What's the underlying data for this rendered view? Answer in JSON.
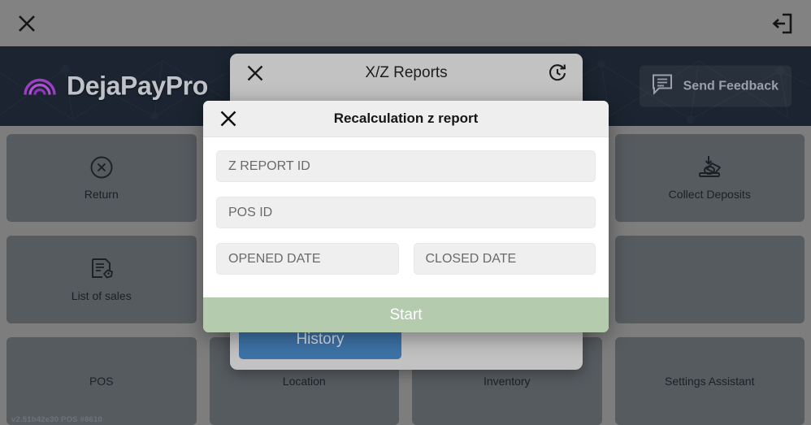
{
  "sysbar": {
    "close_icon": "close-x-icon",
    "logout_icon": "logout-icon"
  },
  "header": {
    "brand_name": "DejaPayPro",
    "brand_icon": "rainbow-arch-logo-icon",
    "feedback_label": "Send Feedback",
    "feedback_icon": "message-bubble-icon",
    "background_color": "#1b2430"
  },
  "tiles": {
    "row1": [
      {
        "label": "Return",
        "icon": "circle-x-icon"
      },
      {
        "label": "",
        "icon": ""
      },
      {
        "label": "",
        "icon": ""
      },
      {
        "label": "Collect Deposits",
        "icon": "collect-cash-icon"
      }
    ],
    "row2": [
      {
        "label": "List of sales",
        "icon": "document-tag-icon"
      },
      {
        "label": "",
        "icon": ""
      },
      {
        "label": "",
        "icon": ""
      },
      {
        "label": "",
        "icon": ""
      }
    ],
    "row3": [
      {
        "label": "POS",
        "icon": ""
      },
      {
        "label": "Location",
        "icon": ""
      },
      {
        "label": "Inventory",
        "icon": ""
      },
      {
        "label": "Settings Assistant",
        "icon": ""
      }
    ]
  },
  "version_text": "v2.51b42e30 POS #8610",
  "xz_panel": {
    "title": "X/Z Reports",
    "close_icon": "close-x-icon",
    "refresh_icon": "refresh-clock-icon",
    "tab_active_color": "#d9a02c",
    "tab_inactive_color": "#8d8f93",
    "history_label": "History",
    "history_color": "#3e73a8"
  },
  "modal": {
    "title": "Recalculation z report",
    "close_icon": "close-x-icon",
    "fields": {
      "z_report_id": {
        "value": "",
        "placeholder": "Z REPORT ID"
      },
      "pos_id": {
        "value": "",
        "placeholder": "POS ID"
      },
      "opened_date": {
        "value": "",
        "placeholder": "OPENED DATE"
      },
      "closed_date": {
        "value": "",
        "placeholder": "CLOSED DATE"
      }
    },
    "start_label": "Start",
    "start_color": "#b4cbae"
  }
}
